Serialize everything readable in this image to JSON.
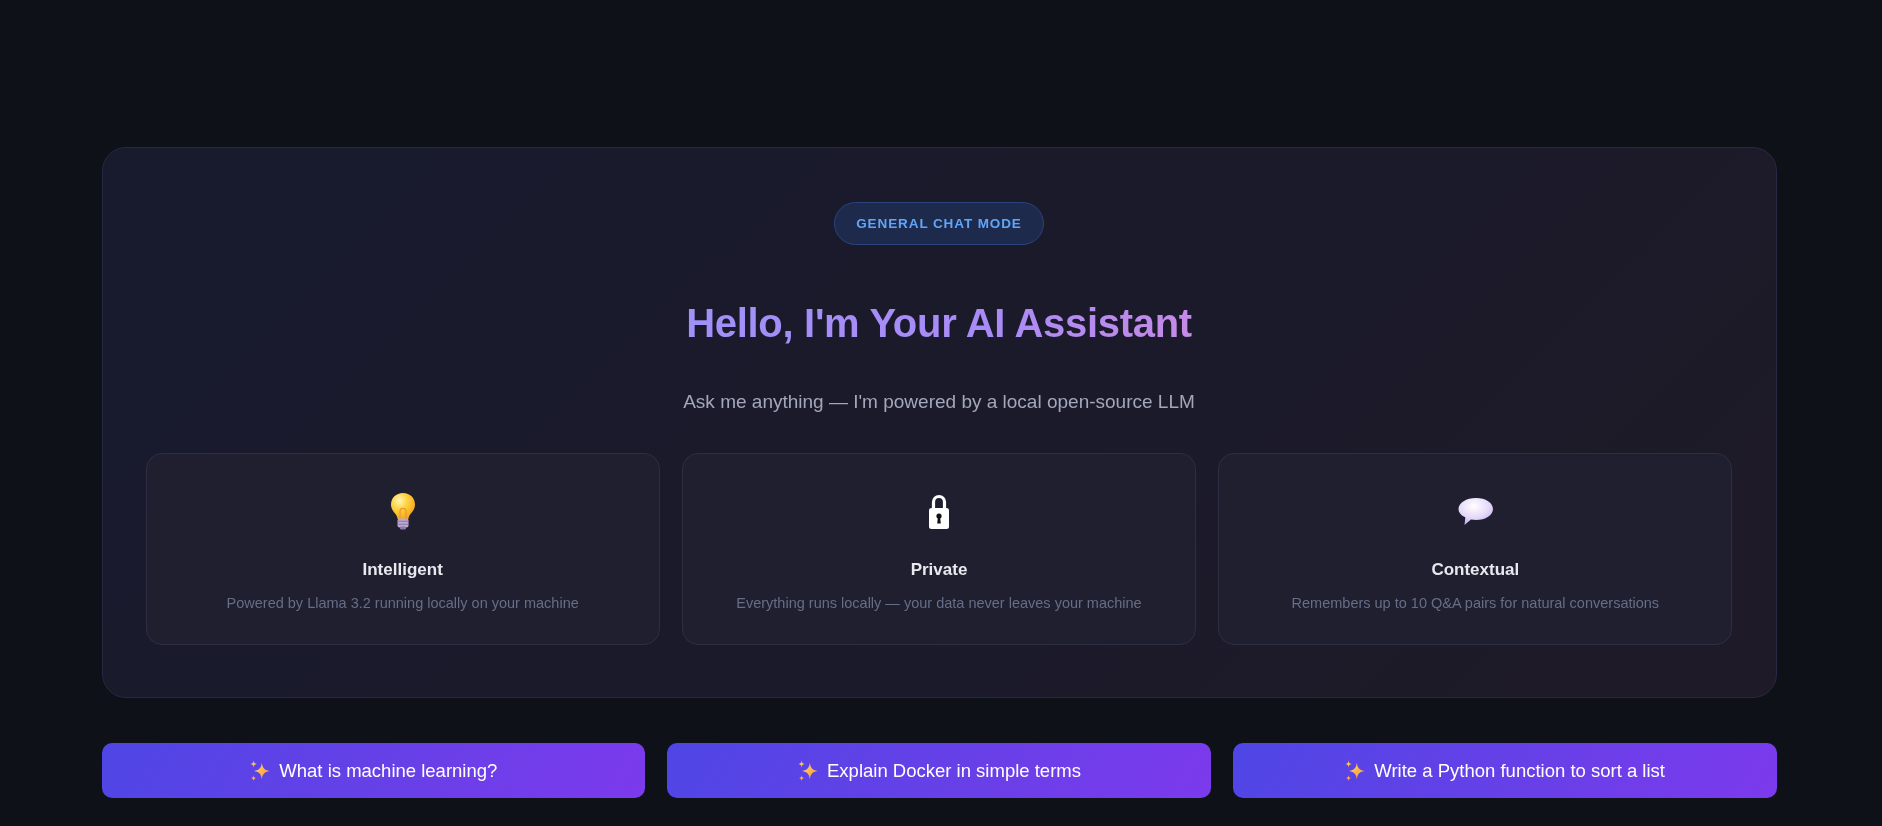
{
  "hero": {
    "badge": "GENERAL CHAT MODE",
    "title": "Hello, I'm Your AI Assistant",
    "subtitle": "Ask me anything — I'm powered by a local open-source LLM"
  },
  "features": [
    {
      "title": "Intelligent",
      "description": "Powered by Llama 3.2 running locally on your machine"
    },
    {
      "title": "Private",
      "description": "Everything runs locally — your data never leaves your machine"
    },
    {
      "title": "Contextual",
      "description": "Remembers up to 10 Q&A pairs for natural conversations"
    }
  ],
  "suggestions": [
    "What is machine learning?",
    "Explain Docker in simple terms",
    "Write a Python function to sort a list"
  ]
}
